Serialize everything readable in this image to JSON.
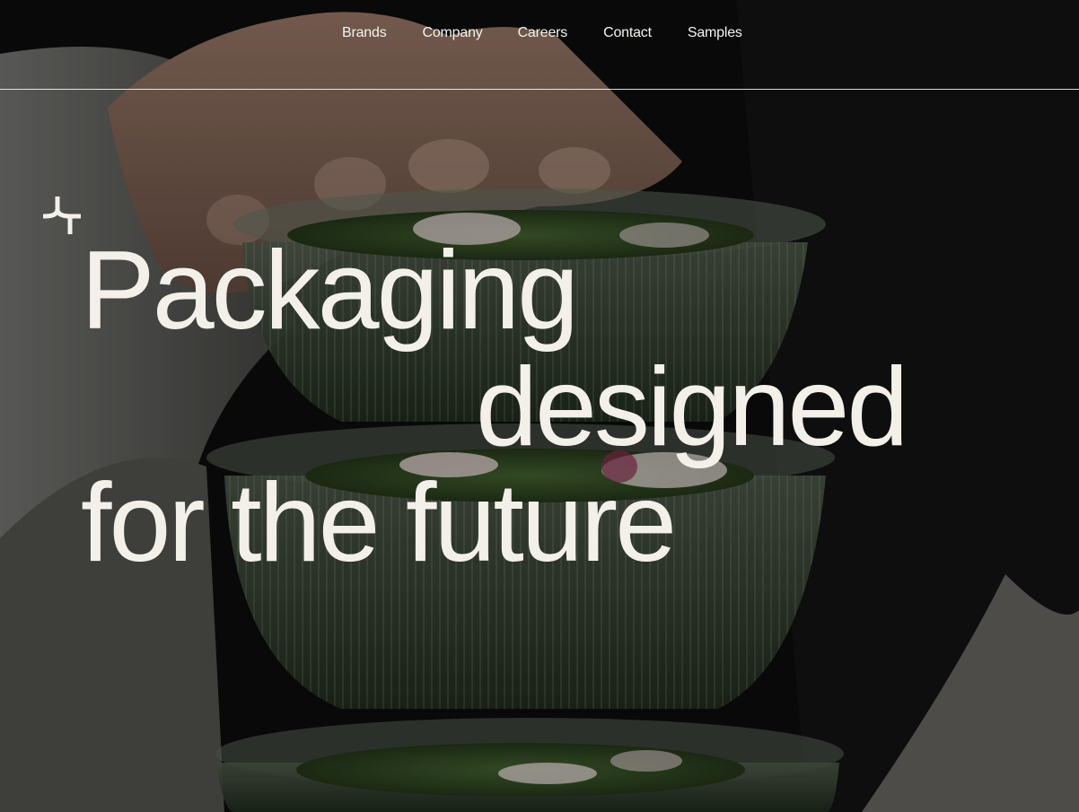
{
  "nav": {
    "items": [
      {
        "label": "Brands"
      },
      {
        "label": "Company"
      },
      {
        "label": "Careers"
      },
      {
        "label": "Contact"
      },
      {
        "label": "Samples"
      }
    ]
  },
  "hero": {
    "headline": {
      "line1": "Packaging",
      "line2": "designed",
      "line3": "for the future"
    },
    "background_image": "stacked clear salad containers with greens held by hand",
    "brand_mark_icon": "logo-mark-icon"
  },
  "colors": {
    "text": "#f3f0ea",
    "background": "#0b0b0b"
  }
}
